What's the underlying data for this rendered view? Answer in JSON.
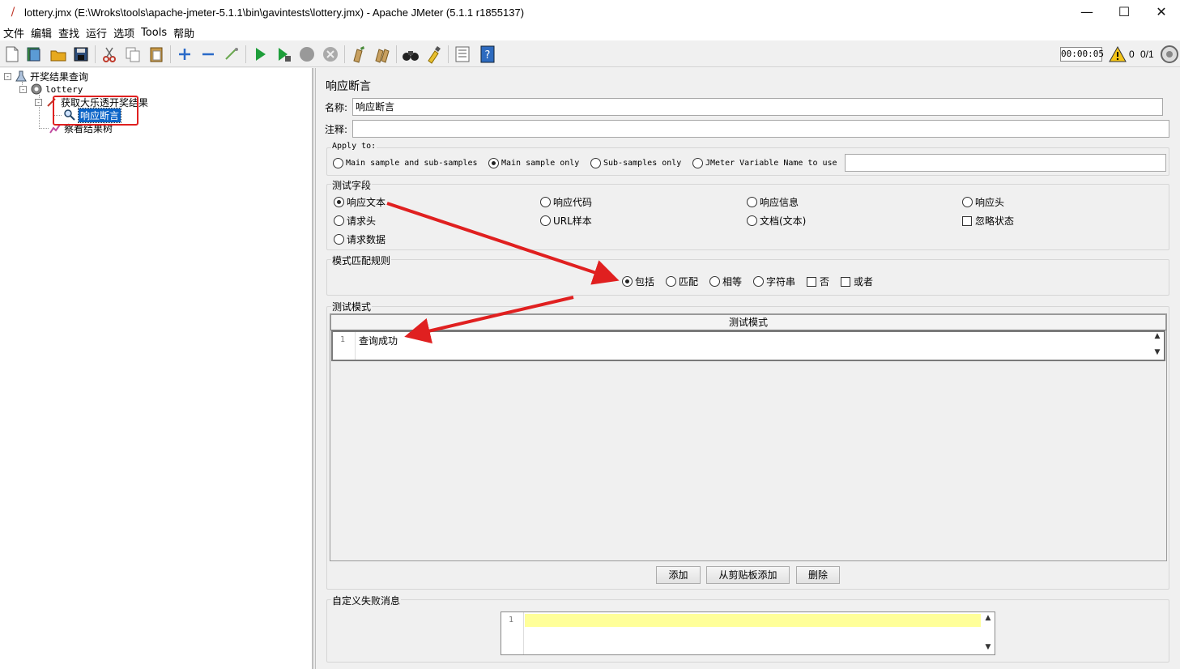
{
  "window": {
    "title": "lottery.jmx (E:\\Wroks\\tools\\apache-jmeter-5.1.1\\bin\\gavintests\\lottery.jmx) - Apache JMeter (5.1.1 r1855137)",
    "minimize": "—",
    "maximize": "☐",
    "close": "✕"
  },
  "menu": [
    "文件",
    "编辑",
    "查找",
    "运行",
    "选项",
    "Tools",
    "帮助"
  ],
  "toolbar": {
    "timer": "00:00:05",
    "warnings": "0",
    "threads": "0/1"
  },
  "tree": {
    "root": "开奖结果查询",
    "thread_group": "lottery",
    "sampler": "获取大乐透开奖结果",
    "assertion": "响应断言",
    "listener": "察看结果树"
  },
  "panel": {
    "title": "响应断言",
    "name_label": "名称:",
    "name_value": "响应断言",
    "comment_label": "注释:",
    "comment_value": "",
    "apply_to": {
      "title": "Apply to:",
      "options": [
        "Main sample and sub-samples",
        "Main sample only",
        "Sub-samples only",
        "JMeter Variable Name to use"
      ],
      "selected": "Main sample only",
      "variable_value": ""
    },
    "test_field": {
      "title": "测试字段",
      "options": [
        "响应文本",
        "响应代码",
        "响应信息",
        "响应头",
        "请求头",
        "URL样本",
        "文档(文本)",
        "请求数据"
      ],
      "ignore_status": "忽略状态",
      "selected": "响应文本"
    },
    "pattern_rules": {
      "title": "模式匹配规则",
      "options": [
        "包括",
        "匹配",
        "相等",
        "字符串"
      ],
      "checkboxes": [
        "否",
        "或者"
      ],
      "selected": "包括"
    },
    "patterns": {
      "title": "测试模式",
      "column_header": "测试模式",
      "rows": [
        {
          "line": "1",
          "text": "查询成功"
        }
      ]
    },
    "buttons": {
      "add": "添加",
      "add_clipboard": "从剪贴板添加",
      "delete": "删除"
    },
    "failure_message": {
      "title": "自定义失败消息",
      "line": "1",
      "value": ""
    }
  },
  "colors": {
    "selection": "#0a64c8",
    "annotation": "#e02020",
    "editor_highlight": "#ffff99"
  }
}
